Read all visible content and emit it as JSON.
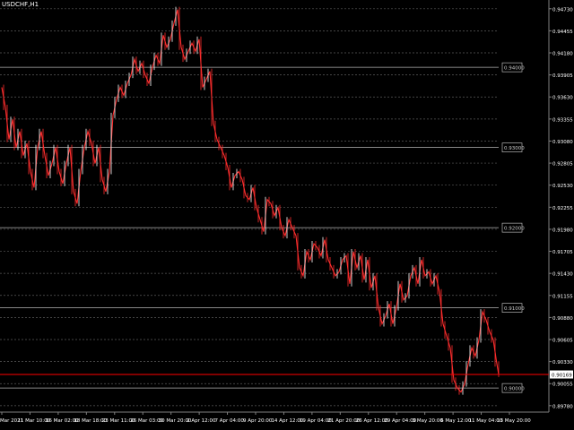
{
  "symbol": "USDCHF,H1",
  "colors": {
    "background": "#000000",
    "grid": "#7f7f7f",
    "price": "#ff2d2d",
    "bull": "#ffffff",
    "bear": "#ff2d2d",
    "current_line": "#ff0000",
    "axis_text": "#ffffff",
    "orange": "#f0a020"
  },
  "chart_data": {
    "type": "line",
    "title": "",
    "xlabel": "",
    "ylabel": "",
    "ylim": [
      0.897,
      0.9475
    ],
    "grid": true,
    "y_ticks": [
      "0.94730",
      "0.94455",
      "0.94180",
      "0.93905",
      "0.93630",
      "0.93355",
      "0.93080",
      "0.92805",
      "0.92530",
      "0.92255",
      "0.91980",
      "0.91705",
      "0.91430",
      "0.91155",
      "0.90880",
      "0.90605",
      "0.90330",
      "0.90055",
      "0.89780"
    ],
    "x_ticks": [
      "Mar 2021",
      "11 Mar 10:00",
      "16 Mar 02:00",
      "18 Mar 18:00",
      "23 Mar 11:00",
      "26 Mar 03:00",
      "30 Mar 20:00",
      "2 Apr 12:00",
      "7 Apr 04:00",
      "9 Apr 20:00",
      "14 Apr 12:00",
      "19 Apr 04:00",
      "21 Apr 20:00",
      "26 Apr 12:00",
      "29 Apr 04:00",
      "3 May 20:00",
      "6 May 12:00",
      "11 May 04:00",
      "13 May 20:00"
    ],
    "round_levels": [
      {
        "label": "0.94000",
        "value": 0.94
      },
      {
        "label": "0.93000",
        "value": 0.93
      },
      {
        "label": "0.92000",
        "value": 0.92
      },
      {
        "label": "0.91000",
        "value": 0.91
      },
      {
        "label": "0.90000",
        "value": 0.9
      }
    ],
    "current_price": {
      "label": "0.90169",
      "value": 0.90169
    },
    "series": [
      {
        "x": [
          0,
          4,
          8,
          12,
          16,
          20,
          24,
          28,
          32,
          36,
          40,
          44,
          48,
          52,
          56,
          60,
          64,
          68,
          72,
          76,
          80,
          84,
          88,
          92,
          96,
          100,
          104,
          108,
          112,
          116,
          120,
          124,
          128,
          132,
          136,
          140,
          144,
          148,
          152,
          156,
          160,
          164,
          168,
          172,
          176,
          180,
          184,
          188,
          192,
          196,
          200,
          204,
          208,
          212,
          216,
          220,
          224,
          228,
          232,
          236,
          240,
          244,
          248,
          252,
          256,
          260,
          264,
          268,
          272,
          276,
          280,
          284,
          288,
          292,
          296,
          300,
          304,
          308,
          312,
          316,
          320,
          324,
          328,
          332,
          336,
          340,
          344,
          348,
          352,
          356,
          360,
          364,
          368,
          372,
          376,
          380,
          384,
          388,
          392,
          396,
          400,
          404,
          408,
          412,
          416,
          420,
          424,
          428,
          432,
          436,
          440,
          444,
          448,
          452,
          456,
          460,
          464,
          468,
          472,
          476,
          480,
          484,
          488,
          492,
          496,
          500,
          504,
          508,
          512,
          516,
          520,
          524,
          528,
          532,
          536,
          540,
          544,
          548,
          552,
          554
        ],
        "values": [
          0.9375,
          0.935,
          0.931,
          0.9335,
          0.93,
          0.932,
          0.929,
          0.9305,
          0.927,
          0.925,
          0.93,
          0.932,
          0.929,
          0.9265,
          0.928,
          0.93,
          0.927,
          0.9255,
          0.928,
          0.93,
          0.9245,
          0.923,
          0.927,
          0.93,
          0.932,
          0.9305,
          0.928,
          0.93,
          0.926,
          0.9245,
          0.927,
          0.934,
          0.936,
          0.9375,
          0.9365,
          0.938,
          0.939,
          0.941,
          0.9395,
          0.9405,
          0.939,
          0.938,
          0.94,
          0.9415,
          0.9405,
          0.944,
          0.9425,
          0.9435,
          0.9455,
          0.9472,
          0.9425,
          0.941,
          0.942,
          0.943,
          0.942,
          0.9435,
          0.9375,
          0.9385,
          0.9395,
          0.933,
          0.931,
          0.93,
          0.929,
          0.9275,
          0.925,
          0.9265,
          0.927,
          0.926,
          0.924,
          0.9235,
          0.925,
          0.9225,
          0.921,
          0.9195,
          0.9235,
          0.923,
          0.9215,
          0.9225,
          0.92,
          0.919,
          0.921,
          0.92,
          0.919,
          0.915,
          0.914,
          0.917,
          0.916,
          0.918,
          0.9175,
          0.9165,
          0.9185,
          0.916,
          0.915,
          0.914,
          0.9145,
          0.916,
          0.9165,
          0.913,
          0.917,
          0.915,
          0.9165,
          0.9135,
          0.916,
          0.9125,
          0.914,
          0.91,
          0.908,
          0.909,
          0.9105,
          0.908,
          0.91,
          0.913,
          0.911,
          0.9115,
          0.914,
          0.915,
          0.913,
          0.916,
          0.914,
          0.9145,
          0.913,
          0.914,
          0.912,
          0.908,
          0.9065,
          0.905,
          0.901,
          0.9,
          0.8995,
          0.9005,
          0.903,
          0.905,
          0.904,
          0.906,
          0.9095,
          0.9085,
          0.907,
          0.906,
          0.903,
          0.9017
        ]
      }
    ]
  }
}
